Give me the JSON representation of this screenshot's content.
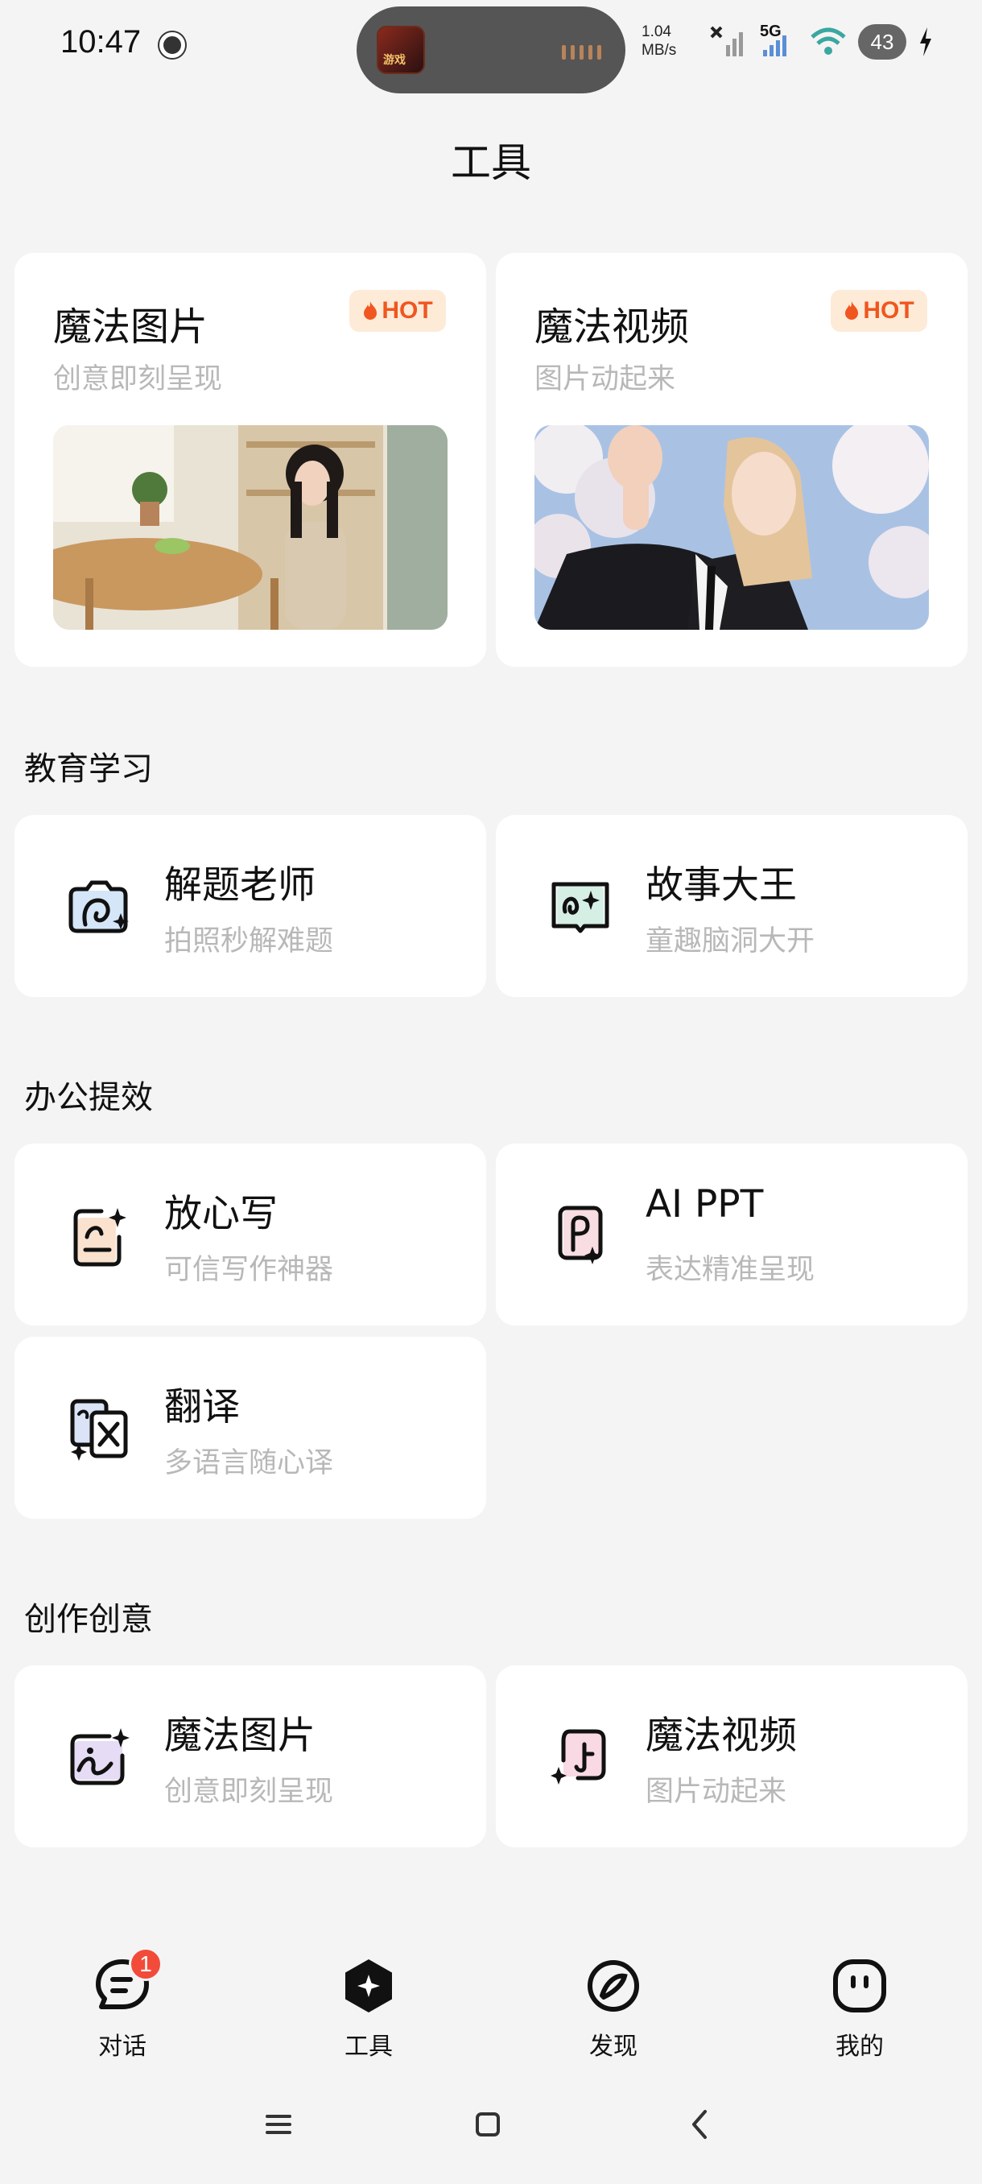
{
  "status_bar": {
    "time": "10:47",
    "net_speed": "1.04",
    "net_unit": "MB/s",
    "network_type": "5G",
    "battery": "43"
  },
  "page": {
    "title": "工具"
  },
  "hot_label": "HOT",
  "hero_cards": [
    {
      "title": "魔法图片",
      "subtitle": "创意即刻呈现",
      "badge": "HOT",
      "image": "woman-at-table-photo"
    },
    {
      "title": "魔法视频",
      "subtitle": "图片动起来",
      "badge": "HOT",
      "image": "woman-waving-cherry-blossom-photo"
    }
  ],
  "sections": [
    {
      "label": "教育学习",
      "items": [
        {
          "title": "解题老师",
          "subtitle": "拍照秒解难题",
          "icon": "camera-sparkle-icon"
        },
        {
          "title": "故事大王",
          "subtitle": "童趣脑洞大开",
          "icon": "story-book-icon"
        }
      ]
    },
    {
      "label": "办公提效",
      "items": [
        {
          "title": "放心写",
          "subtitle": "可信写作神器",
          "icon": "writing-icon"
        },
        {
          "title": "AI PPT",
          "subtitle": "表达精准呈现",
          "icon": "ppt-icon"
        },
        {
          "title": "翻译",
          "subtitle": "多语言随心译",
          "icon": "translate-icon"
        }
      ]
    },
    {
      "label": "创作创意",
      "items": [
        {
          "title": "魔法图片",
          "subtitle": "创意即刻呈现",
          "icon": "magic-image-icon"
        },
        {
          "title": "魔法视频",
          "subtitle": "图片动起来",
          "icon": "magic-video-icon"
        }
      ]
    }
  ],
  "bottom_nav": [
    {
      "label": "对话",
      "icon": "chat-icon",
      "badge": "1"
    },
    {
      "label": "工具",
      "icon": "tools-icon",
      "active": true
    },
    {
      "label": "发现",
      "icon": "discover-icon"
    },
    {
      "label": "我的",
      "icon": "profile-icon"
    }
  ],
  "colors": {
    "accent": "#f0561f",
    "badge": "#f24b3a",
    "subtext": "#b8b8b8",
    "background": "#f4f4f4"
  }
}
